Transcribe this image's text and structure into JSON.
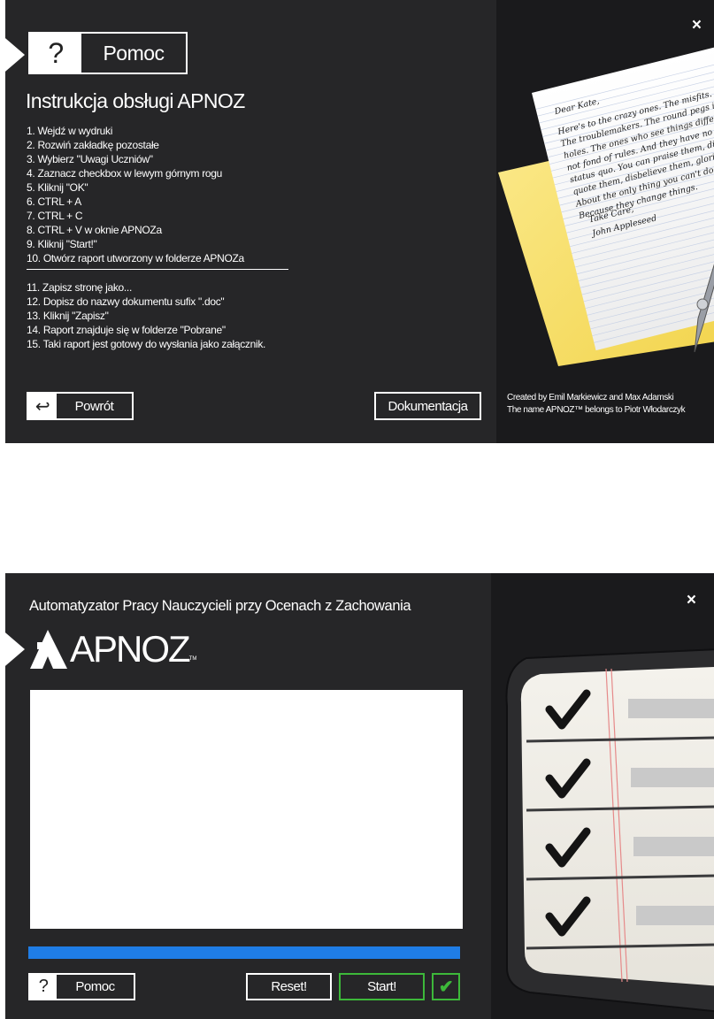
{
  "help_window": {
    "header_label": "Pomoc",
    "header_icon": "?",
    "title": "Instrukcja obsługi APNOZ",
    "steps_a": [
      "1. Wejdź w wydruki",
      "2. Rozwiń zakładkę pozostałe",
      "3. Wybierz \"Uwagi Uczniów\"",
      "4. Zaznacz checkbox w lewym górnym rogu",
      "5. Kliknij \"OK\"",
      "6. CTRL + A",
      "7. CTRL + C",
      "8. CTRL + V w oknie APNOZa",
      "9. Kliknij \"Start!\"",
      "10. Otwórz raport utworzony w folderze APNOZa"
    ],
    "steps_b": [
      "11. Zapisz stronę jako...",
      "12. Dopisz do nazwy dokumentu sufix \".doc\"",
      "13. Kliknij \"Zapisz\"",
      "14. Raport znajduje się w folderze \"Pobrane\"",
      "15. Taki raport jest gotowy do wysłania jako załącznik."
    ],
    "back_label": "Powrót",
    "back_icon": "↩",
    "docs_label": "Dokumentacja",
    "close": "×",
    "credits_line1": "Created by Emil Markiewicz and Max Adamski",
    "credits_line2": "The name APNOZ™ belongs to Piotr Włodarczyk",
    "letter": {
      "greeting": "Dear Kate,",
      "body": [
        "Here's to the crazy ones. The misfits. The reb",
        "The troublemakers. The round pegs in the sq",
        "holes. The ones who see things differently. T",
        "not fond of rules. And they have no respect",
        "status quo. You can praise them, disagree",
        "quote them, disbelieve them, glorify or vi",
        "About the only thing you can't do is ig",
        "Because they change things."
      ],
      "closing": "Take Care,",
      "signature": "John Appleseed"
    }
  },
  "main_window": {
    "subtitle": "Automatyzator Pracy Nauczycieli przy Ocenach z Zachowania",
    "logo_text": "APNOZ",
    "logo_tm": "TM",
    "log_text": "",
    "progress": 1.0,
    "accent": "#1f7de6",
    "start_color": "#3db83a",
    "help_label": "Pomoc",
    "help_icon": "?",
    "reset_label": "Reset!",
    "start_label": "Start!",
    "check": "✔",
    "close": "×"
  }
}
